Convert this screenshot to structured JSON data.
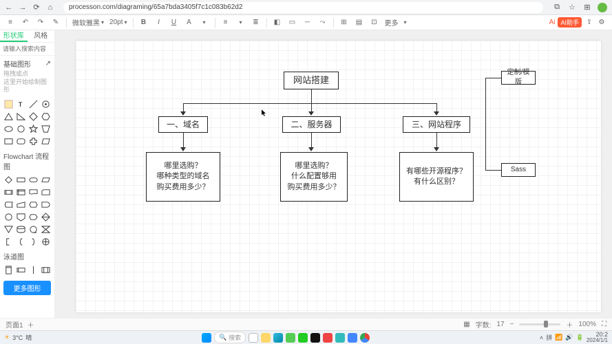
{
  "browser": {
    "url": "processon.com/diagraming/65a7bda3405f7c1c083b62d2"
  },
  "toolbar": {
    "undo_label": "↶",
    "redo_label": "↷",
    "font_family": "微软雅黑",
    "font_size": "20pt",
    "more_label": "更多",
    "ai_text": "Ai",
    "ai_badge": "AI助手"
  },
  "sidebar": {
    "tab_shapes": "形状库",
    "tab_style": "风格",
    "search_placeholder": "请输入搜索内容",
    "section_basic": "基础图形",
    "hint_line1": "拖拽或点",
    "hint_line2": "这里开始绘制图形",
    "section_flowchart": "Flowchart 流程图",
    "section_pool": "泳道图",
    "more_shapes": "更多图形"
  },
  "diagram": {
    "root": "网站搭建",
    "col1_title": "一、域名",
    "col1_body": "哪里选购？\n哪种类型的域名\n购买费用多少？",
    "col2_title": "二、服务器",
    "col2_body": "哪里选购？\n什么配置够用\n购买费用多少？",
    "col3_title": "三、网站程序",
    "col3_body": "有哪些开源程序？\n有什么区别？",
    "side_top": "定制/模版",
    "side_bottom": "Sass"
  },
  "status": {
    "page_label": "页面1",
    "word_count_label": "字数:",
    "word_count": "17",
    "zoom": "100%"
  },
  "taskbar": {
    "weather_temp": "3°C",
    "weather_desc": "晴",
    "search_placeholder": "搜索",
    "time": "20:2",
    "date": "2024/1/1"
  }
}
